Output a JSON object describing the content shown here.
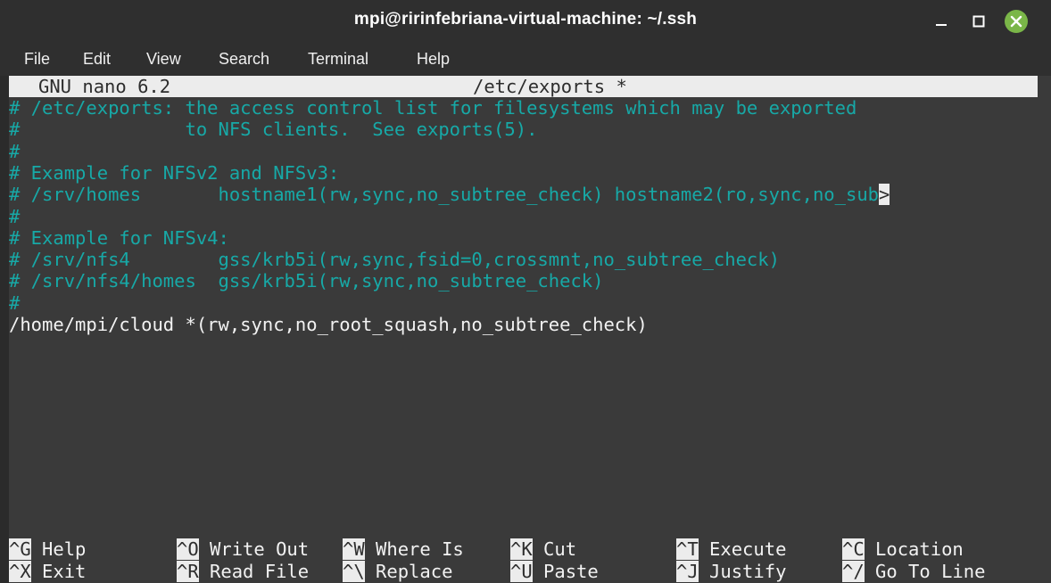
{
  "window": {
    "title": "mpi@ririnfebriana-virtual-machine: ~/.ssh",
    "minimize_icon": "minimize-icon",
    "maximize_icon": "maximize-icon",
    "close_icon": "close-icon",
    "close_color": "#7ab648"
  },
  "menu": [
    "File",
    "Edit",
    "View",
    "Search",
    "Terminal",
    "Help"
  ],
  "nano": {
    "version": "GNU nano 6.2",
    "filename": "/etc/exports *",
    "lines": [
      {
        "text": "# /etc/exports: the access control list for filesystems which may be exported",
        "type": "comment"
      },
      {
        "text": "#               to NFS clients.  See exports(5).",
        "type": "comment"
      },
      {
        "text": "#",
        "type": "comment"
      },
      {
        "text": "# Example for NFSv2 and NFSv3:",
        "type": "comment"
      },
      {
        "text": "# /srv/homes       hostname1(rw,sync,no_subtree_check) hostname2(ro,sync,no_sub",
        "type": "comment",
        "truncated": ">"
      },
      {
        "text": "#",
        "type": "comment"
      },
      {
        "text": "# Example for NFSv4:",
        "type": "comment"
      },
      {
        "text": "# /srv/nfs4        gss/krb5i(rw,sync,fsid=0,crossmnt,no_subtree_check)",
        "type": "comment"
      },
      {
        "text": "# /srv/nfs4/homes  gss/krb5i(rw,sync,no_subtree_check)",
        "type": "comment"
      },
      {
        "text": "#",
        "type": "comment"
      },
      {
        "text": "/home/mpi/cloud *(rw,sync,no_root_squash,no_subtree_check)",
        "type": "normal"
      }
    ],
    "shortcuts_row1": [
      {
        "key": "^G",
        "label": "Help"
      },
      {
        "key": "^O",
        "label": "Write Out"
      },
      {
        "key": "^W",
        "label": "Where Is"
      },
      {
        "key": "^K",
        "label": "Cut"
      },
      {
        "key": "^T",
        "label": "Execute"
      },
      {
        "key": "^C",
        "label": "Location"
      }
    ],
    "shortcuts_row2": [
      {
        "key": "^X",
        "label": "Exit"
      },
      {
        "key": "^R",
        "label": "Read File"
      },
      {
        "key": "^\\",
        "label": "Replace"
      },
      {
        "key": "^U",
        "label": "Paste"
      },
      {
        "key": "^J",
        "label": "Justify"
      },
      {
        "key": "^/",
        "label": "Go To Line"
      }
    ]
  },
  "colors": {
    "comment": "#17a9a7",
    "text": "#f2f2f2",
    "background": "#3a3a3a",
    "highlight": "#ececec"
  }
}
